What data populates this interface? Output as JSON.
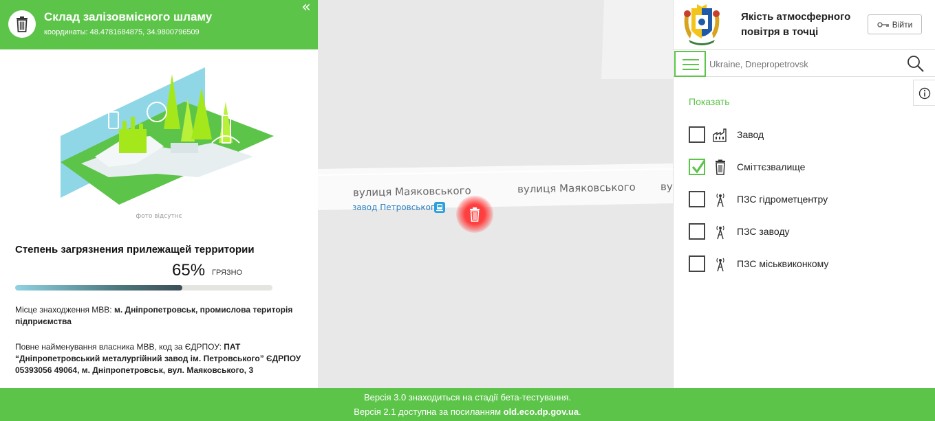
{
  "left_panel": {
    "title": "Склад залізовмісного шламу",
    "coords_label": "координаты:",
    "coords_value": "48.4781684875, 34.9800796509",
    "collapse_glyph": "«",
    "photo_note": "фото відсутнє",
    "pollution_title": "Степень загрязнения прилежащей территории",
    "pollution_percent": 65,
    "pollution_value": "65%",
    "pollution_status": "ГРЯЗНО",
    "location_label": "Місце знаходження МВВ:",
    "location_value": "м. Дніпропетровськ, промислова територія підприємства",
    "owner_label": "Повне найменування власника МВВ, код за ЄДРПОУ:",
    "owner_value": "ПАТ “Дніпропетровський металургійний завод ім. Петровського” ЄДРПОУ 05393056 49064, м. Дніпропетровськ, вул. Маяковського, 3"
  },
  "map": {
    "streets": [
      "вулиця Маяковського",
      "вулиця Маяковського",
      "ву"
    ],
    "poi_label": "завод Петровського",
    "marker_icon": "trash-icon"
  },
  "right_panel": {
    "title": "Якість атмосферного повітря в точці",
    "login_label": "Війти",
    "search_placeholder": "Ukraine, Dnepropetrovsk",
    "show_label": "Показать",
    "layers": [
      {
        "label": "Завод",
        "checked": false,
        "icon": "factory-icon"
      },
      {
        "label": "Сміттєзвалище",
        "checked": true,
        "icon": "trash-icon"
      },
      {
        "label": "ПЗС гідрометцентру",
        "checked": false,
        "icon": "tower-icon"
      },
      {
        "label": "ПЗС заводу",
        "checked": false,
        "icon": "tower-icon"
      },
      {
        "label": "ПЗС міськвиконкому",
        "checked": false,
        "icon": "tower-icon"
      }
    ]
  },
  "footer": {
    "line1": "Версія 3.0 знаходиться на стадії бета-тестування.",
    "line2_prefix": "Версія 2.1 доступна за посиланням ",
    "line2_link": "old.eco.dp.gov.ua",
    "line2_suffix": "."
  },
  "colors": {
    "accent": "#5dc44a",
    "marker": "#ff3b3b",
    "poi": "#2a7fc1"
  }
}
